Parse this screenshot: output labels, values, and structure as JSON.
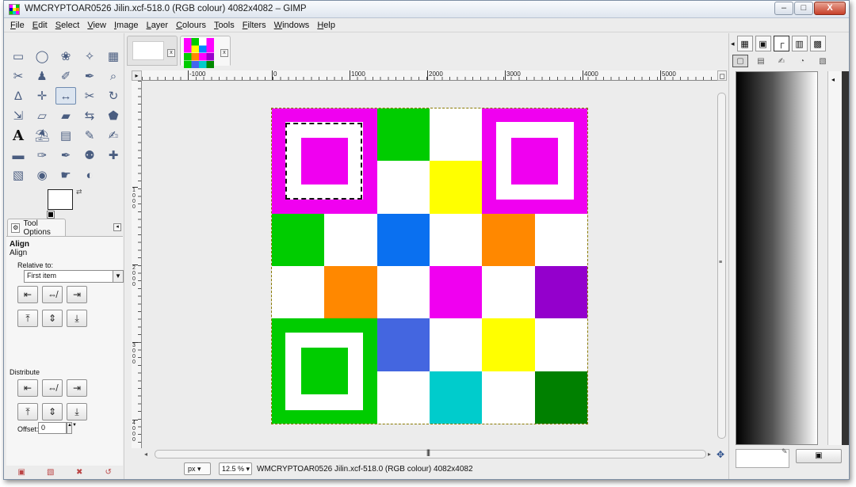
{
  "window": {
    "title": "WMCRYPTOAR0526 Jilin.xcf-518.0 (RGB colour) 4082x4082 – GIMP",
    "buttons": {
      "minimize": "–",
      "maximize": "□",
      "close": "X"
    }
  },
  "menu": [
    "File",
    "Edit",
    "Select",
    "View",
    "Image",
    "Layer",
    "Colours",
    "Tools",
    "Filters",
    "Windows",
    "Help"
  ],
  "toolbox": {
    "tools": [
      {
        "name": "rect-select-icon",
        "glyph": "▭"
      },
      {
        "name": "ellipse-select-icon",
        "glyph": "◯"
      },
      {
        "name": "free-select-icon",
        "glyph": "❀"
      },
      {
        "name": "fuzzy-select-icon",
        "glyph": "✧"
      },
      {
        "name": "select-by-color-icon",
        "glyph": "▦"
      },
      {
        "name": "scissors-select-icon",
        "glyph": "✂"
      },
      {
        "name": "foreground-select-icon",
        "glyph": "♟"
      },
      {
        "name": "paths-icon",
        "glyph": "✐"
      },
      {
        "name": "color-picker-icon",
        "glyph": "✒"
      },
      {
        "name": "zoom-icon",
        "glyph": "⌕"
      },
      {
        "name": "measure-icon",
        "glyph": "∆"
      },
      {
        "name": "move-icon",
        "glyph": "✛"
      },
      {
        "name": "align-icon",
        "glyph": "↔"
      },
      {
        "name": "crop-icon",
        "glyph": "✂"
      },
      {
        "name": "rotate-icon",
        "glyph": "↻"
      },
      {
        "name": "scale-icon",
        "glyph": "⇲"
      },
      {
        "name": "shear-icon",
        "glyph": "▱"
      },
      {
        "name": "perspective-icon",
        "glyph": "▰"
      },
      {
        "name": "flip-icon",
        "glyph": "⇆"
      },
      {
        "name": "cage-icon",
        "glyph": "⬟"
      },
      {
        "name": "text-icon",
        "glyph": "A"
      },
      {
        "name": "bucket-fill-icon",
        "glyph": "⛱"
      },
      {
        "name": "blend-icon",
        "glyph": "▤"
      },
      {
        "name": "pencil-icon",
        "glyph": "✎"
      },
      {
        "name": "paintbrush-icon",
        "glyph": "✍"
      },
      {
        "name": "eraser-icon",
        "glyph": "▬"
      },
      {
        "name": "airbrush-icon",
        "glyph": "✑"
      },
      {
        "name": "ink-icon",
        "glyph": "✒"
      },
      {
        "name": "clone-icon",
        "glyph": "⚉"
      },
      {
        "name": "heal-icon",
        "glyph": "✚"
      },
      {
        "name": "perspective-clone-icon",
        "glyph": "▧"
      },
      {
        "name": "blur-icon",
        "glyph": "◉"
      },
      {
        "name": "smudge-icon",
        "glyph": "☛"
      },
      {
        "name": "dodge-burn-icon",
        "glyph": "◐"
      }
    ],
    "active_tool_index": 12,
    "tab_label": "Tool Options",
    "options": {
      "header": "Align",
      "subheader": "Align",
      "relative_label": "Relative to:",
      "relative_value": "First item",
      "distribute_label": "Distribute",
      "offset_label": "Offset:",
      "offset_value": "0",
      "align_buttons": [
        "⇤",
        "⇎",
        "⇥",
        "⤒",
        "⇕",
        "⤓"
      ],
      "distribute_buttons": [
        "⇤",
        "⇎",
        "⇥",
        "⤒",
        "⇕",
        "⤓"
      ]
    },
    "bottom_icons": [
      "▣",
      "▧",
      "✖",
      "↺"
    ]
  },
  "image_tabs": [
    "blank-image",
    "qr-image"
  ],
  "rulers": {
    "h_labels": [
      "-1000",
      "0",
      "1000",
      "2000",
      "3000",
      "4000",
      "5000"
    ],
    "v_labels": [
      "1000",
      "2000",
      "3000",
      "4000"
    ]
  },
  "qr": {
    "cells": [
      "#f000f0",
      "#f000f0",
      "#00cc00",
      "#ffffff",
      "#f000f0",
      "#f000f0",
      "#f000f0",
      "#f000f0",
      "#ffffff",
      "#ffff00",
      "#f000f0",
      "#f000f0",
      "#00cc00",
      "#ffffff",
      "#0a70f0",
      "#ffffff",
      "#ff8800",
      "#ffffff",
      "#ffffff",
      "#ff8800",
      "#ffffff",
      "#f000f0",
      "#ffffff",
      "#9400cc",
      "#00cc00",
      "#00cc00",
      "#4466e0",
      "#ffffff",
      "#ffff00",
      "#ffffff",
      "#00cc00",
      "#00cc00",
      "#ffffff",
      "#00cccc",
      "#ffffff",
      "#008000"
    ],
    "finder_colors": {
      "top_left": "#f000f0",
      "top_right": "#f000f0",
      "bottom_left": "#00cc00"
    }
  },
  "status": {
    "unit": "px",
    "zoom": "12.5 %",
    "text": "WMCRYPTOAR0526 Jilin.xcf-518.0 (RGB colour) 4082x4082"
  },
  "dock": {
    "tabs_top": [
      "▦",
      "▣",
      "┌",
      "▥",
      "▩"
    ],
    "tabs_second": [
      "▢",
      "▤",
      "✍",
      "◔",
      "▧"
    ],
    "bottom_button": "▣"
  }
}
